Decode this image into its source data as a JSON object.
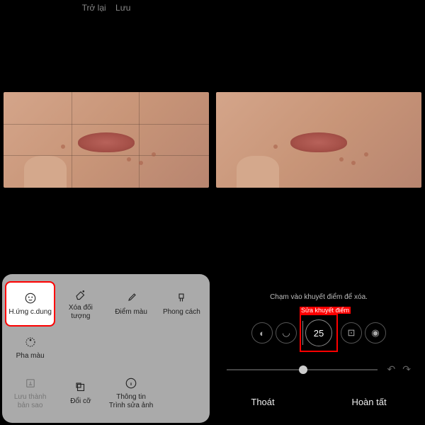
{
  "header": {
    "back": "Trở lại",
    "save": "Lưu"
  },
  "tools": {
    "portrait": "H.ứng c.dung",
    "erase_object": "Xóa đối tượng",
    "spot_color": "Điểm màu",
    "style": "Phong cách",
    "color_mix": "Pha màu",
    "save_copy": "Lưu thành bản sao",
    "resize": "Đổi cỡ",
    "editor_info": "Thông tin Trình sửa ảnh"
  },
  "right": {
    "hint": "Chạm vào khuyết điểm để xóa.",
    "fix_label": "Sửa khuyết điểm",
    "size_value": "25",
    "exit": "Thoát",
    "done": "Hoàn tất"
  }
}
